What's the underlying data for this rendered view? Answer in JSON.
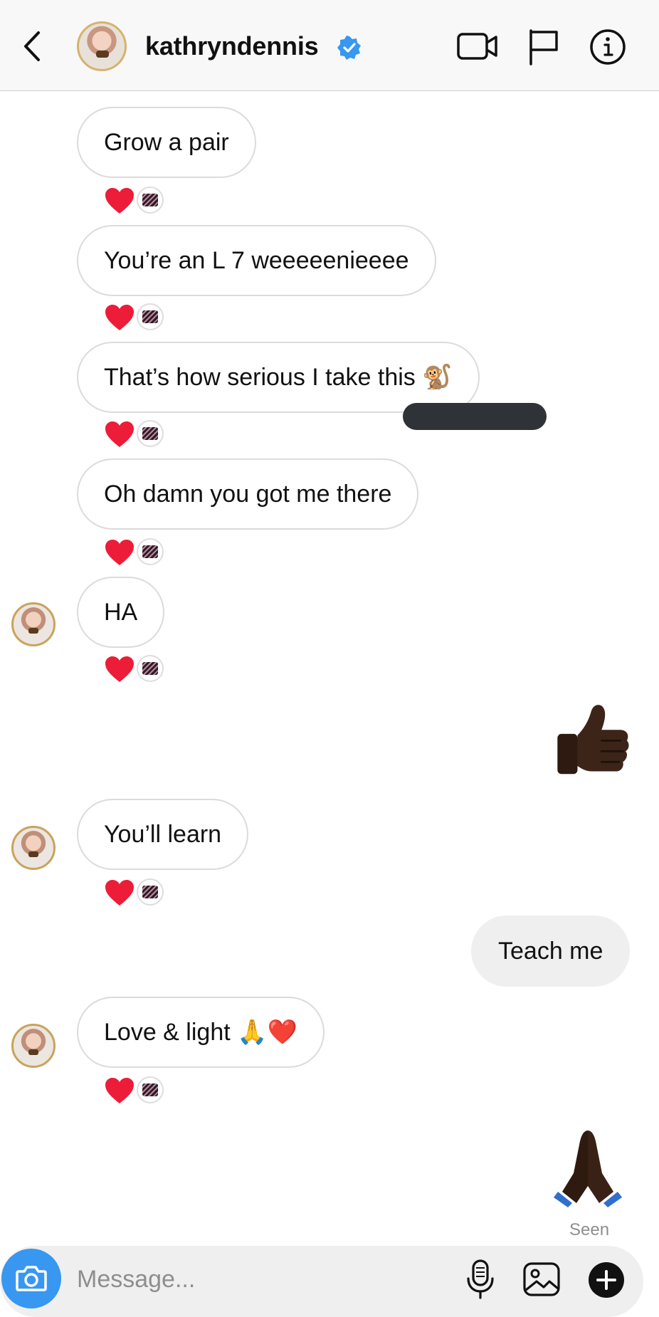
{
  "header": {
    "username": "kathryndennis"
  },
  "messages": [
    {
      "side": "received",
      "text": "Grow a pair",
      "reaction": "❤️"
    },
    {
      "side": "received",
      "text": "You’re an L 7 weeeeenieeee",
      "reaction": "❤️"
    },
    {
      "side": "received",
      "text": "That’s how serious I take this 🐒",
      "reaction": "❤️"
    },
    {
      "side": "received",
      "text": "Oh damn you got me there",
      "reaction": "❤️"
    },
    {
      "side": "received",
      "text": "HA",
      "reaction": "❤️"
    },
    {
      "side": "sent",
      "emoji": "thumbs-up"
    },
    {
      "side": "received",
      "text": "You’ll learn",
      "reaction": "❤️"
    },
    {
      "side": "sent",
      "text": "Teach me"
    },
    {
      "side": "received",
      "text": "Love & light 🙏❤️",
      "reaction": "❤️"
    },
    {
      "side": "sent",
      "emoji": "folded-hands"
    }
  ],
  "status": {
    "seen": "Seen"
  },
  "composer": {
    "placeholder": "Message..."
  },
  "colors": {
    "accent": "#3897f0",
    "verified": "#3897f0",
    "heart": "#ed1c39",
    "bubble_border": "#dbdbdb",
    "sent_bubble": "#efefef"
  },
  "icons": {
    "back": "chevron-left-icon",
    "video": "video-call-icon",
    "flag": "flag-icon",
    "info": "info-icon",
    "camera": "camera-icon",
    "mic": "microphone-icon",
    "gallery": "gallery-icon",
    "plus": "plus-icon"
  }
}
